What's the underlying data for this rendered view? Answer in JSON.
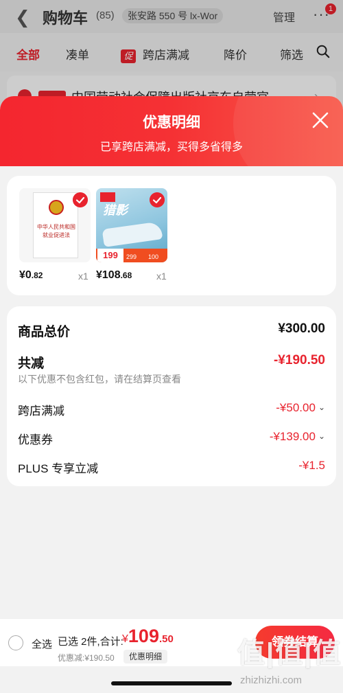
{
  "under": {
    "title": "购物车",
    "count": "(85)",
    "address": "张安路 550 号 lx-Wor",
    "manage": "管理",
    "more": "···",
    "badge": "1",
    "tabs": [
      "全部",
      "凑单",
      "跨店满减",
      "降价",
      "筛选"
    ],
    "promo_mark": "促",
    "store_name": "中国劳动社会保障出版社京东自营官"
  },
  "sheet": {
    "title": "优惠明细",
    "subtitle": "已享跨店满减，买得多省得多"
  },
  "products": [
    {
      "name": "中华人民共和国就业促进法",
      "price_int": "¥0",
      "price_dec": ".82",
      "qty": "x1"
    },
    {
      "name": "猎影",
      "price_int": "¥108",
      "price_dec": ".68",
      "qty": "x1",
      "img_price": "199",
      "img_p2": "299",
      "img_p3": "100"
    }
  ],
  "summary": {
    "total_label": "商品总价",
    "total_value": "¥300.00",
    "reduce_label": "共减",
    "reduce_value": "-¥190.50",
    "note": "以下优惠不包含红包，请在结算页查看",
    "items": [
      {
        "label": "跨店满减",
        "value": "-¥50.00"
      },
      {
        "label": "优惠券",
        "value": "-¥139.00"
      },
      {
        "label": "PLUS 专享立减",
        "value": "-¥1.5"
      }
    ]
  },
  "bottom": {
    "select_all": "全选",
    "picked": "已选 2件,合计:",
    "currency": "¥",
    "total_int": "109",
    "total_dec": ".50",
    "discount": "优惠减:¥190.50",
    "detail_chip": "优惠明细",
    "checkout": "领券结算"
  },
  "watermark": {
    "text": "值|值|值",
    "url": "zhizhizhi.com"
  },
  "colors": {
    "accent": "#e8232e",
    "header_gradient_start": "#f4262f",
    "header_gradient_end": "#f8594a"
  }
}
